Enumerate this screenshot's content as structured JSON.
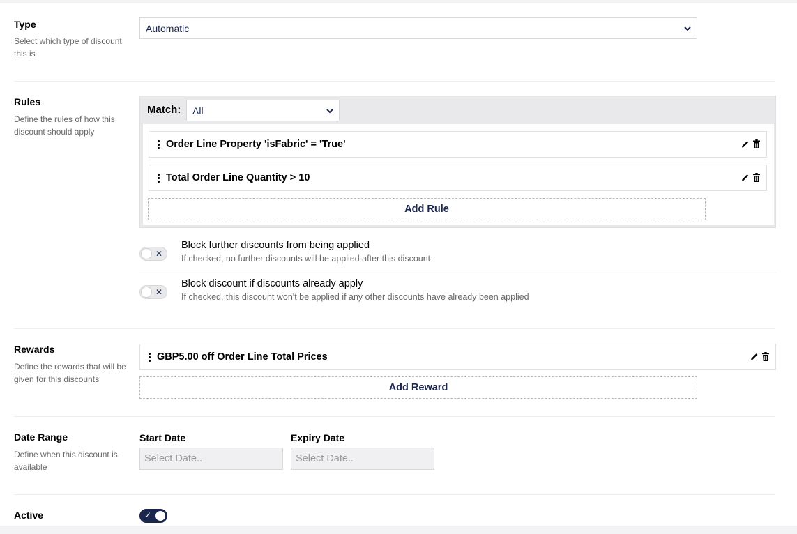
{
  "type_section": {
    "title": "Type",
    "description": "Select which type of discount this is",
    "selected": "Automatic"
  },
  "rules_section": {
    "title": "Rules",
    "description": "Define the rules of how this discount should apply",
    "match_label": "Match:",
    "match_selected": "All",
    "rules": [
      {
        "label": "Order Line Property 'isFabric' = 'True'"
      },
      {
        "label": "Total Order Line Quantity > 10"
      }
    ],
    "add_label": "Add Rule"
  },
  "options": [
    {
      "title": "Block further discounts from being applied",
      "description": "If checked, no further discounts will be applied after this discount",
      "checked": false
    },
    {
      "title": "Block discount if discounts already apply",
      "description": "If checked, this discount won't be applied if any other discounts have already been applied",
      "checked": false
    }
  ],
  "rewards_section": {
    "title": "Rewards",
    "description": "Define the rewards that will be given for this discounts",
    "rewards": [
      {
        "label": "GBP5.00 off Order Line Total Prices"
      }
    ],
    "add_label": "Add Reward"
  },
  "date_section": {
    "title": "Date Range",
    "description": "Define when this discount is available",
    "start_label": "Start Date",
    "start_placeholder": "Select Date..",
    "expiry_label": "Expiry Date",
    "expiry_placeholder": "Select Date.."
  },
  "active_section": {
    "title": "Active",
    "checked": true
  },
  "colors": {
    "accent": "#1b264f",
    "border": "#d8d7d9",
    "muted_text": "#68676b"
  }
}
